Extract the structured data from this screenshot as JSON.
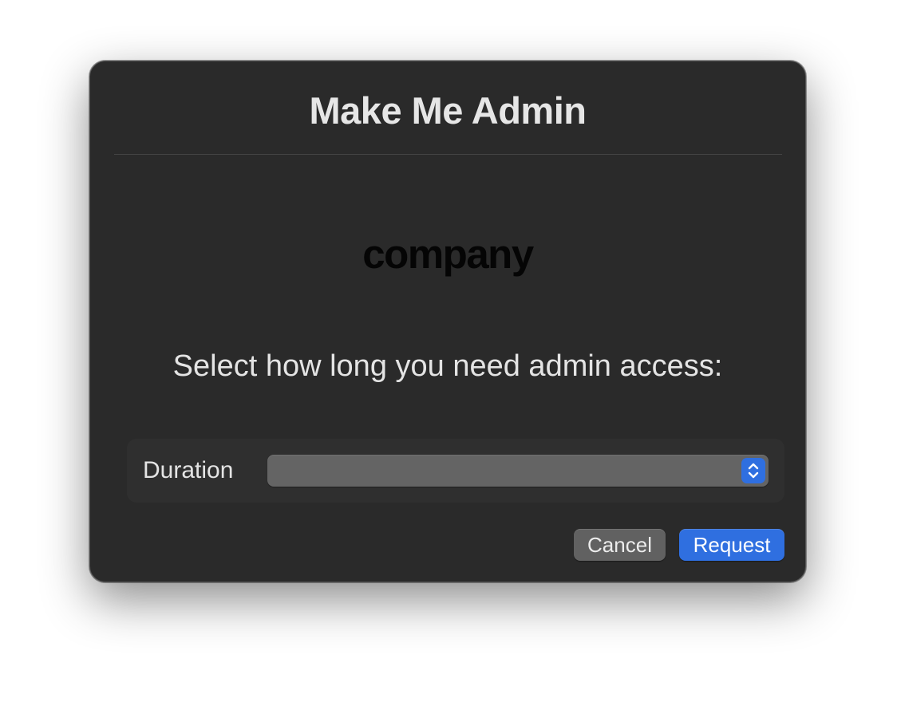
{
  "dialog": {
    "title": "Make Me Admin",
    "logo_text": "company",
    "prompt": "Select how long you need admin access:"
  },
  "form": {
    "duration_label": "Duration",
    "duration_value": ""
  },
  "buttons": {
    "cancel_label": "Cancel",
    "request_label": "Request"
  },
  "icons": {
    "stepper": "chevron-up-down-icon"
  },
  "colors": {
    "dialog_background": "#2a2a2a",
    "accent": "#2f6fe0",
    "popup_background": "#646464",
    "secondary_button": "#616161"
  }
}
